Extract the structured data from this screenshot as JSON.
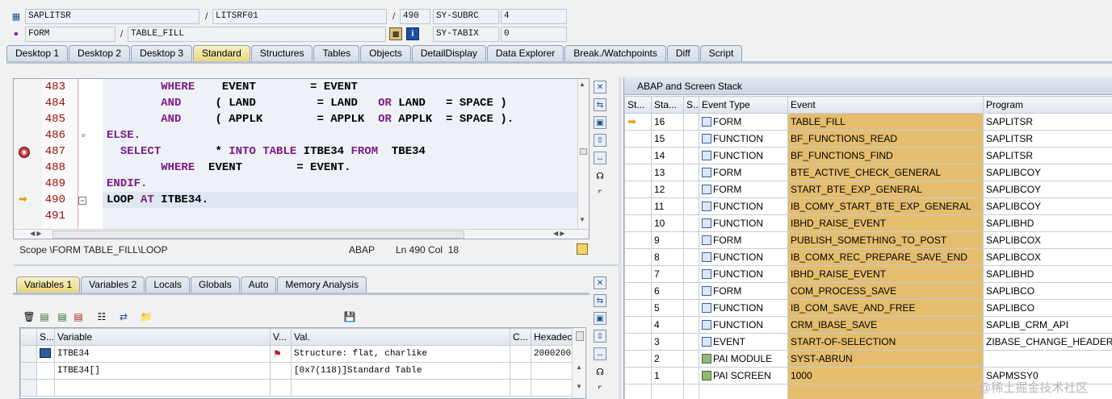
{
  "header": {
    "program": "SAPLITSR",
    "include": "LITSRF01",
    "line": "490",
    "subrc_label": "SY-SUBRC",
    "subrc_value": "4",
    "block_type": "FORM",
    "block_name": "TABLE_FILL",
    "tabix_label": "SY-TABIX",
    "tabix_value": "0"
  },
  "tabs": [
    "Desktop 1",
    "Desktop 2",
    "Desktop 3",
    "Standard",
    "Structures",
    "Tables",
    "Objects",
    "DetailDisplay",
    "Data Explorer",
    "Break./Watchpoints",
    "Diff",
    "Script"
  ],
  "active_tab": "Standard",
  "code": [
    {
      "num": "483",
      "parts": [
        [
          "kw",
          "WHERE"
        ],
        [
          "t",
          "    EVENT        = EVENT"
        ]
      ],
      "indent": "        "
    },
    {
      "num": "484",
      "parts": [
        [
          "kw",
          "AND"
        ],
        [
          "t",
          "     ( LAND         = LAND   "
        ],
        [
          "kw",
          "OR"
        ],
        [
          "t",
          " LAND   = SPACE )"
        ]
      ],
      "indent": "        "
    },
    {
      "num": "485",
      "parts": [
        [
          "kw",
          "AND"
        ],
        [
          "t",
          "     ( APPLK        = APPLK  "
        ],
        [
          "kw",
          "OR"
        ],
        [
          "t",
          " APPLK  = SPACE )."
        ]
      ],
      "indent": "        "
    },
    {
      "num": "486",
      "parts": [
        [
          "kw",
          "ELSE."
        ]
      ],
      "indent": ""
    },
    {
      "num": "487",
      "parts": [
        [
          "kw",
          "SELECT"
        ],
        [
          "t",
          "        * "
        ],
        [
          "kw",
          "INTO TABLE"
        ],
        [
          "t",
          " ITBE34 "
        ],
        [
          "kw",
          "FROM"
        ],
        [
          "t",
          "  TBE34"
        ]
      ],
      "indent": "  "
    },
    {
      "num": "488",
      "parts": [
        [
          "kw",
          "WHERE"
        ],
        [
          "t",
          "  EVENT        = EVENT."
        ]
      ],
      "indent": "        "
    },
    {
      "num": "489",
      "parts": [
        [
          "kw",
          "ENDIF."
        ]
      ],
      "indent": ""
    },
    {
      "num": "490",
      "parts": [
        [
          "t",
          "LOOP "
        ],
        [
          "kw",
          "AT"
        ],
        [
          "t",
          " ITBE34."
        ]
      ],
      "indent": ""
    },
    {
      "num": "491",
      "parts": [],
      "indent": ""
    }
  ],
  "status": {
    "scope": "Scope \\FORM TABLE_FILL\\LOOP",
    "lang": "ABAP",
    "pos": "Ln 490 Col  18"
  },
  "var_tabs": [
    "Variables 1",
    "Variables 2",
    "Locals",
    "Globals",
    "Auto",
    "Memory Analysis"
  ],
  "var_active": "Variables 1",
  "var_columns": [
    "S...",
    "Variable",
    "V...",
    "Val.",
    "C...",
    "Hexadec"
  ],
  "var_rows": [
    {
      "variable": "ITBE34",
      "value": "Structure: flat, charlike",
      "hex": "2000200"
    },
    {
      "variable": "ITBE34[]",
      "value": "[0x7(118)]Standard Table",
      "hex": ""
    }
  ],
  "stack": {
    "title": "ABAP and Screen Stack",
    "columns": [
      "St...",
      "Sta...",
      "S...",
      "Event Type",
      "Event",
      "Program"
    ],
    "rows": [
      {
        "level": "16",
        "type": "FORM",
        "event": "TABLE_FILL",
        "program": "SAPLITSR",
        "current": true,
        "pai": false
      },
      {
        "level": "15",
        "type": "FUNCTION",
        "event": "BF_FUNCTIONS_READ",
        "program": "SAPLITSR",
        "pai": false
      },
      {
        "level": "14",
        "type": "FUNCTION",
        "event": "BF_FUNCTIONS_FIND",
        "program": "SAPLITSR",
        "pai": false
      },
      {
        "level": "13",
        "type": "FORM",
        "event": "BTE_ACTIVE_CHECK_GENERAL",
        "program": "SAPLIBCOY",
        "pai": false
      },
      {
        "level": "12",
        "type": "FORM",
        "event": "START_BTE_EXP_GENERAL",
        "program": "SAPLIBCOY",
        "pai": false
      },
      {
        "level": "11",
        "type": "FUNCTION",
        "event": "IB_COMY_START_BTE_EXP_GENERAL",
        "program": "SAPLIBCOY",
        "pai": false
      },
      {
        "level": "10",
        "type": "FUNCTION",
        "event": "IBHD_RAISE_EVENT",
        "program": "SAPLIBHD",
        "pai": false
      },
      {
        "level": "9",
        "type": "FORM",
        "event": "PUBLISH_SOMETHING_TO_POST",
        "program": "SAPLIBCOX",
        "pai": false
      },
      {
        "level": "8",
        "type": "FUNCTION",
        "event": "IB_COMX_REC_PREPARE_SAVE_END",
        "program": "SAPLIBCOX",
        "pai": false
      },
      {
        "level": "7",
        "type": "FUNCTION",
        "event": "IBHD_RAISE_EVENT",
        "program": "SAPLIBHD",
        "pai": false
      },
      {
        "level": "6",
        "type": "FORM",
        "event": "COM_PROCESS_SAVE",
        "program": "SAPLIBCO",
        "pai": false
      },
      {
        "level": "5",
        "type": "FUNCTION",
        "event": "IB_COM_SAVE_AND_FREE",
        "program": "SAPLIBCO",
        "pai": false
      },
      {
        "level": "4",
        "type": "FUNCTION",
        "event": "CRM_IBASE_SAVE",
        "program": "SAPLIB_CRM_API",
        "pai": false
      },
      {
        "level": "3",
        "type": "EVENT",
        "event": "START-OF-SELECTION",
        "program": "ZIBASE_CHANGE_HEADER",
        "pai": false
      },
      {
        "level": "2",
        "type": "PAI MODULE",
        "event": "SYST-ABRUN",
        "program": "",
        "pai": true
      },
      {
        "level": "1",
        "type": "PAI SCREEN",
        "event": "1000",
        "program": "SAPMSSY0",
        "pai": true
      }
    ]
  },
  "watermark": "@稀土掘金技术社区",
  "colors": {
    "event_highlight": "#e5bd6e",
    "active_tab": "#ecd985",
    "keyword": "#7d1b84",
    "line_number": "#a01010"
  }
}
